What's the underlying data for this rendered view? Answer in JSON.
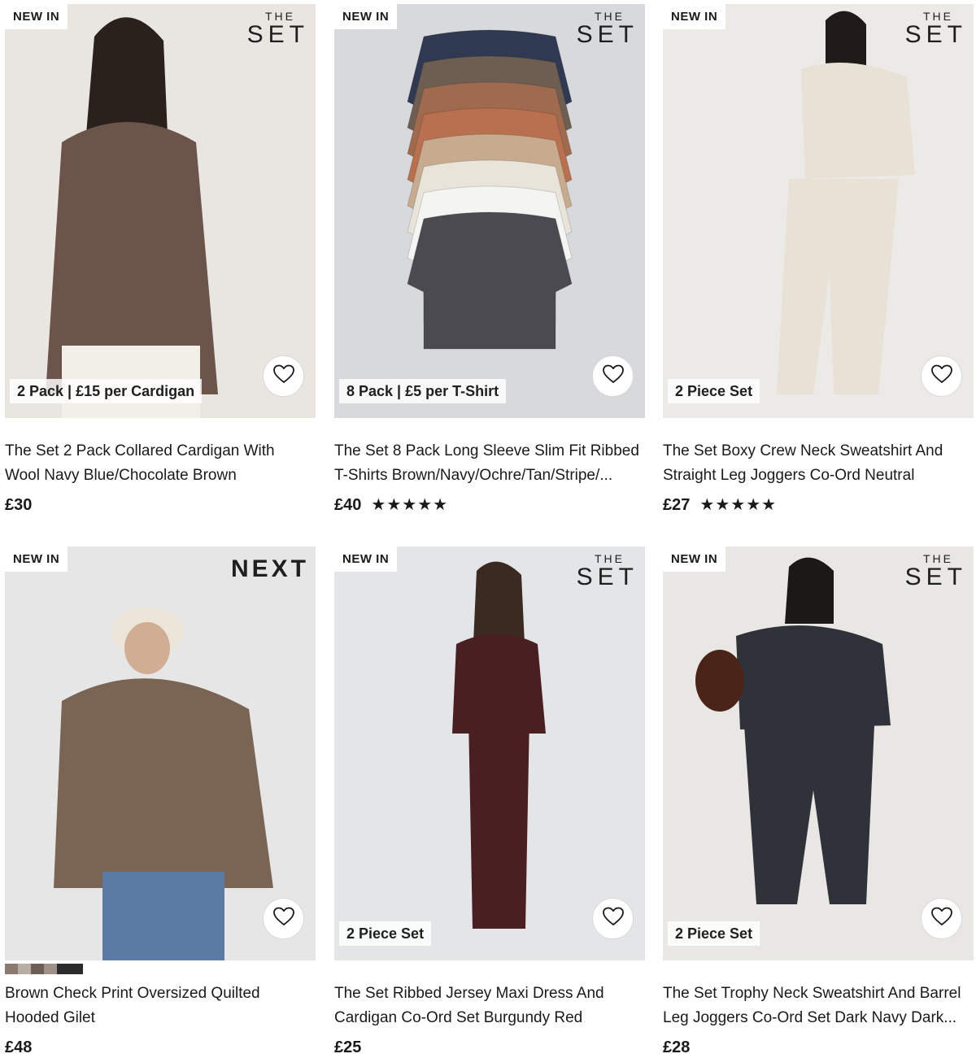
{
  "products": [
    {
      "badge": "NEW IN",
      "brand_small": "THE",
      "brand_big": "SET",
      "promo": "2 Pack | £15 per Cardigan",
      "title_line1": "The Set 2 Pack Collared Cardigan With",
      "title_line2": "Wool Navy Blue/Chocolate Brown",
      "price": "£30",
      "rating": 0,
      "bg": "#e9e6e2",
      "garment": "#6b5449",
      "icon": "cardigan-model-image"
    },
    {
      "badge": "NEW IN",
      "brand_small": "THE",
      "brand_big": "SET",
      "promo": "8 Pack | £5 per T-Shirt",
      "title_line1": "The Set 8 Pack Long Sleeve Slim Fit Ribbed",
      "title_line2": "T-Shirts Brown/Navy/Ochre/Tan/Stripe/...",
      "price": "£40",
      "rating": 5,
      "bg": "#d7d9dc",
      "garment": "#4a4a50",
      "icon": "tshirts-stack-image"
    },
    {
      "badge": "NEW IN",
      "brand_small": "THE",
      "brand_big": "SET",
      "promo": "2 Piece Set",
      "title_line1": "The Set Boxy Crew Neck Sweatshirt And",
      "title_line2": "Straight Leg Joggers Co-Ord Neutral",
      "price": "£27",
      "rating": 5,
      "bg": "#eceae6",
      "garment": "#e7e1d6",
      "icon": "neutral-coord-model-image"
    },
    {
      "badge": "NEW IN",
      "brand_small": "",
      "brand_big": "NEXT",
      "promo": "",
      "title_line1": "Brown Check Print Oversized Quilted",
      "title_line2": "Hooded Gilet",
      "price": "£48",
      "rating": 0,
      "bg": "#e3e3e3",
      "garment": "#7a6454",
      "icon": "quilted-gilet-model-image"
    },
    {
      "badge": "NEW IN",
      "brand_small": "THE",
      "brand_big": "SET",
      "promo": "2 Piece Set",
      "title_line1": "The Set Ribbed Jersey Maxi Dress And",
      "title_line2": "Cardigan Co-Ord Set Burgundy Red",
      "price": "£25",
      "rating": 0,
      "bg": "#e4e5e7",
      "garment": "#4a1f22",
      "icon": "burgundy-dress-model-image"
    },
    {
      "badge": "NEW IN",
      "brand_small": "THE",
      "brand_big": "SET",
      "promo": "2 Piece Set",
      "title_line1": "The Set Trophy Neck Sweatshirt And Barrel",
      "title_line2": "Leg Joggers Co-Ord Set Dark Navy Dark...",
      "price": "£28",
      "rating": 0,
      "bg": "#e8e7e4",
      "garment": "#2f3238",
      "icon": "navy-coord-model-image"
    }
  ]
}
